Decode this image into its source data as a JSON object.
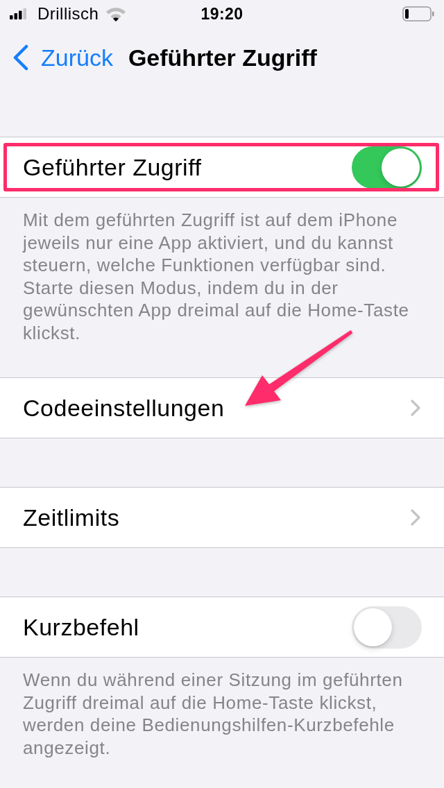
{
  "status_bar": {
    "carrier": "Drillisch",
    "time": "19:20"
  },
  "nav_bar": {
    "back_label": "Zurück",
    "title": "Geführter Zugriff"
  },
  "sections": [
    {
      "rows": [
        {
          "kind": "toggle",
          "label": "Geführter Zugriff",
          "on": true,
          "highlighted": true,
          "arrow": false
        }
      ],
      "footer": "Mit dem geführten Zugriff ist auf dem iPhone jeweils nur eine App aktiviert, und du kannst steuern, welche Funktionen verfügbar sind. Starte diesen Modus, indem du in der gewünschten App dreimal auf die Home-Taste klickst."
    },
    {
      "rows": [
        {
          "kind": "link",
          "label": "Codeeinstellungen",
          "highlighted": false,
          "arrow": true
        }
      ]
    },
    {
      "rows": [
        {
          "kind": "link",
          "label": "Zeitlimits",
          "highlighted": false,
          "arrow": false
        }
      ]
    },
    {
      "rows": [
        {
          "kind": "toggle",
          "label": "Kurzbefehl",
          "on": false,
          "highlighted": false,
          "arrow": false
        }
      ],
      "footer": "Wenn du während einer Sitzung im geführten Zugriff dreimal auf die Home-Taste klickst, werden deine Bedienungshilfen-Kurzbefehle angezeigt."
    }
  ]
}
